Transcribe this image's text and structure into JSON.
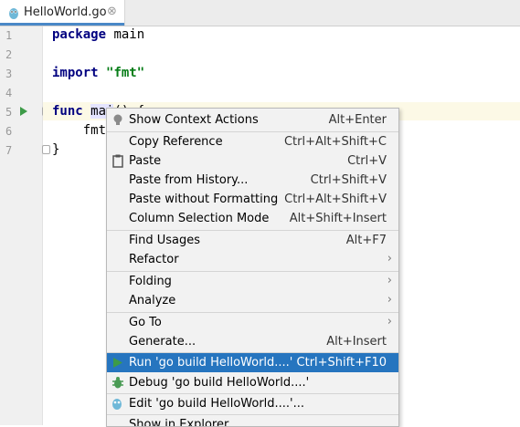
{
  "tab": {
    "title": "HelloWorld.go",
    "close": "⊗"
  },
  "gutter": {
    "lines": [
      "1",
      "2",
      "3",
      "4",
      "5",
      "6",
      "7"
    ]
  },
  "code": {
    "l1_kw": "package",
    "l1_rest": " main",
    "l3_kw": "import",
    "l3_str": "\"fmt\"",
    "l5_kw": "func",
    "l5_name": "mai",
    "l5_rest": "() {",
    "l6": "    fmt.",
    "l7": "}"
  },
  "menu": {
    "items": [
      {
        "label": "Show Context Actions",
        "shortcut": "Alt+Enter",
        "icon": "bulb-icon"
      },
      {
        "label": "Copy Reference",
        "shortcut": "Ctrl+Alt+Shift+C"
      },
      {
        "label": "Paste",
        "shortcut": "Ctrl+V",
        "icon": "clipboard-icon"
      },
      {
        "label": "Paste from History...",
        "shortcut": "Ctrl+Shift+V"
      },
      {
        "label": "Paste without Formatting",
        "shortcut": "Ctrl+Alt+Shift+V"
      },
      {
        "label": "Column Selection Mode",
        "shortcut": "Alt+Shift+Insert"
      },
      {
        "label": "Find Usages",
        "shortcut": "Alt+F7"
      },
      {
        "label": "Refactor",
        "submenu": true
      },
      {
        "label": "Folding",
        "submenu": true
      },
      {
        "label": "Analyze",
        "submenu": true
      },
      {
        "label": "Go To",
        "submenu": true
      },
      {
        "label": "Generate...",
        "shortcut": "Alt+Insert"
      },
      {
        "label": "Run 'go build HelloWorld....'",
        "shortcut": "Ctrl+Shift+F10",
        "icon": "run-icon",
        "selected": true
      },
      {
        "label": "Debug 'go build HelloWorld....'",
        "icon": "debug-icon"
      },
      {
        "label": "Edit 'go build HelloWorld....'...",
        "icon": "edit-config-icon"
      },
      {
        "label": "Show in Explorer"
      }
    ],
    "submenu_arrow": "›"
  },
  "colors": {
    "selection": "#2675bf",
    "keyword": "#000080",
    "string": "#067d17",
    "run_green": "#3d9b48"
  }
}
